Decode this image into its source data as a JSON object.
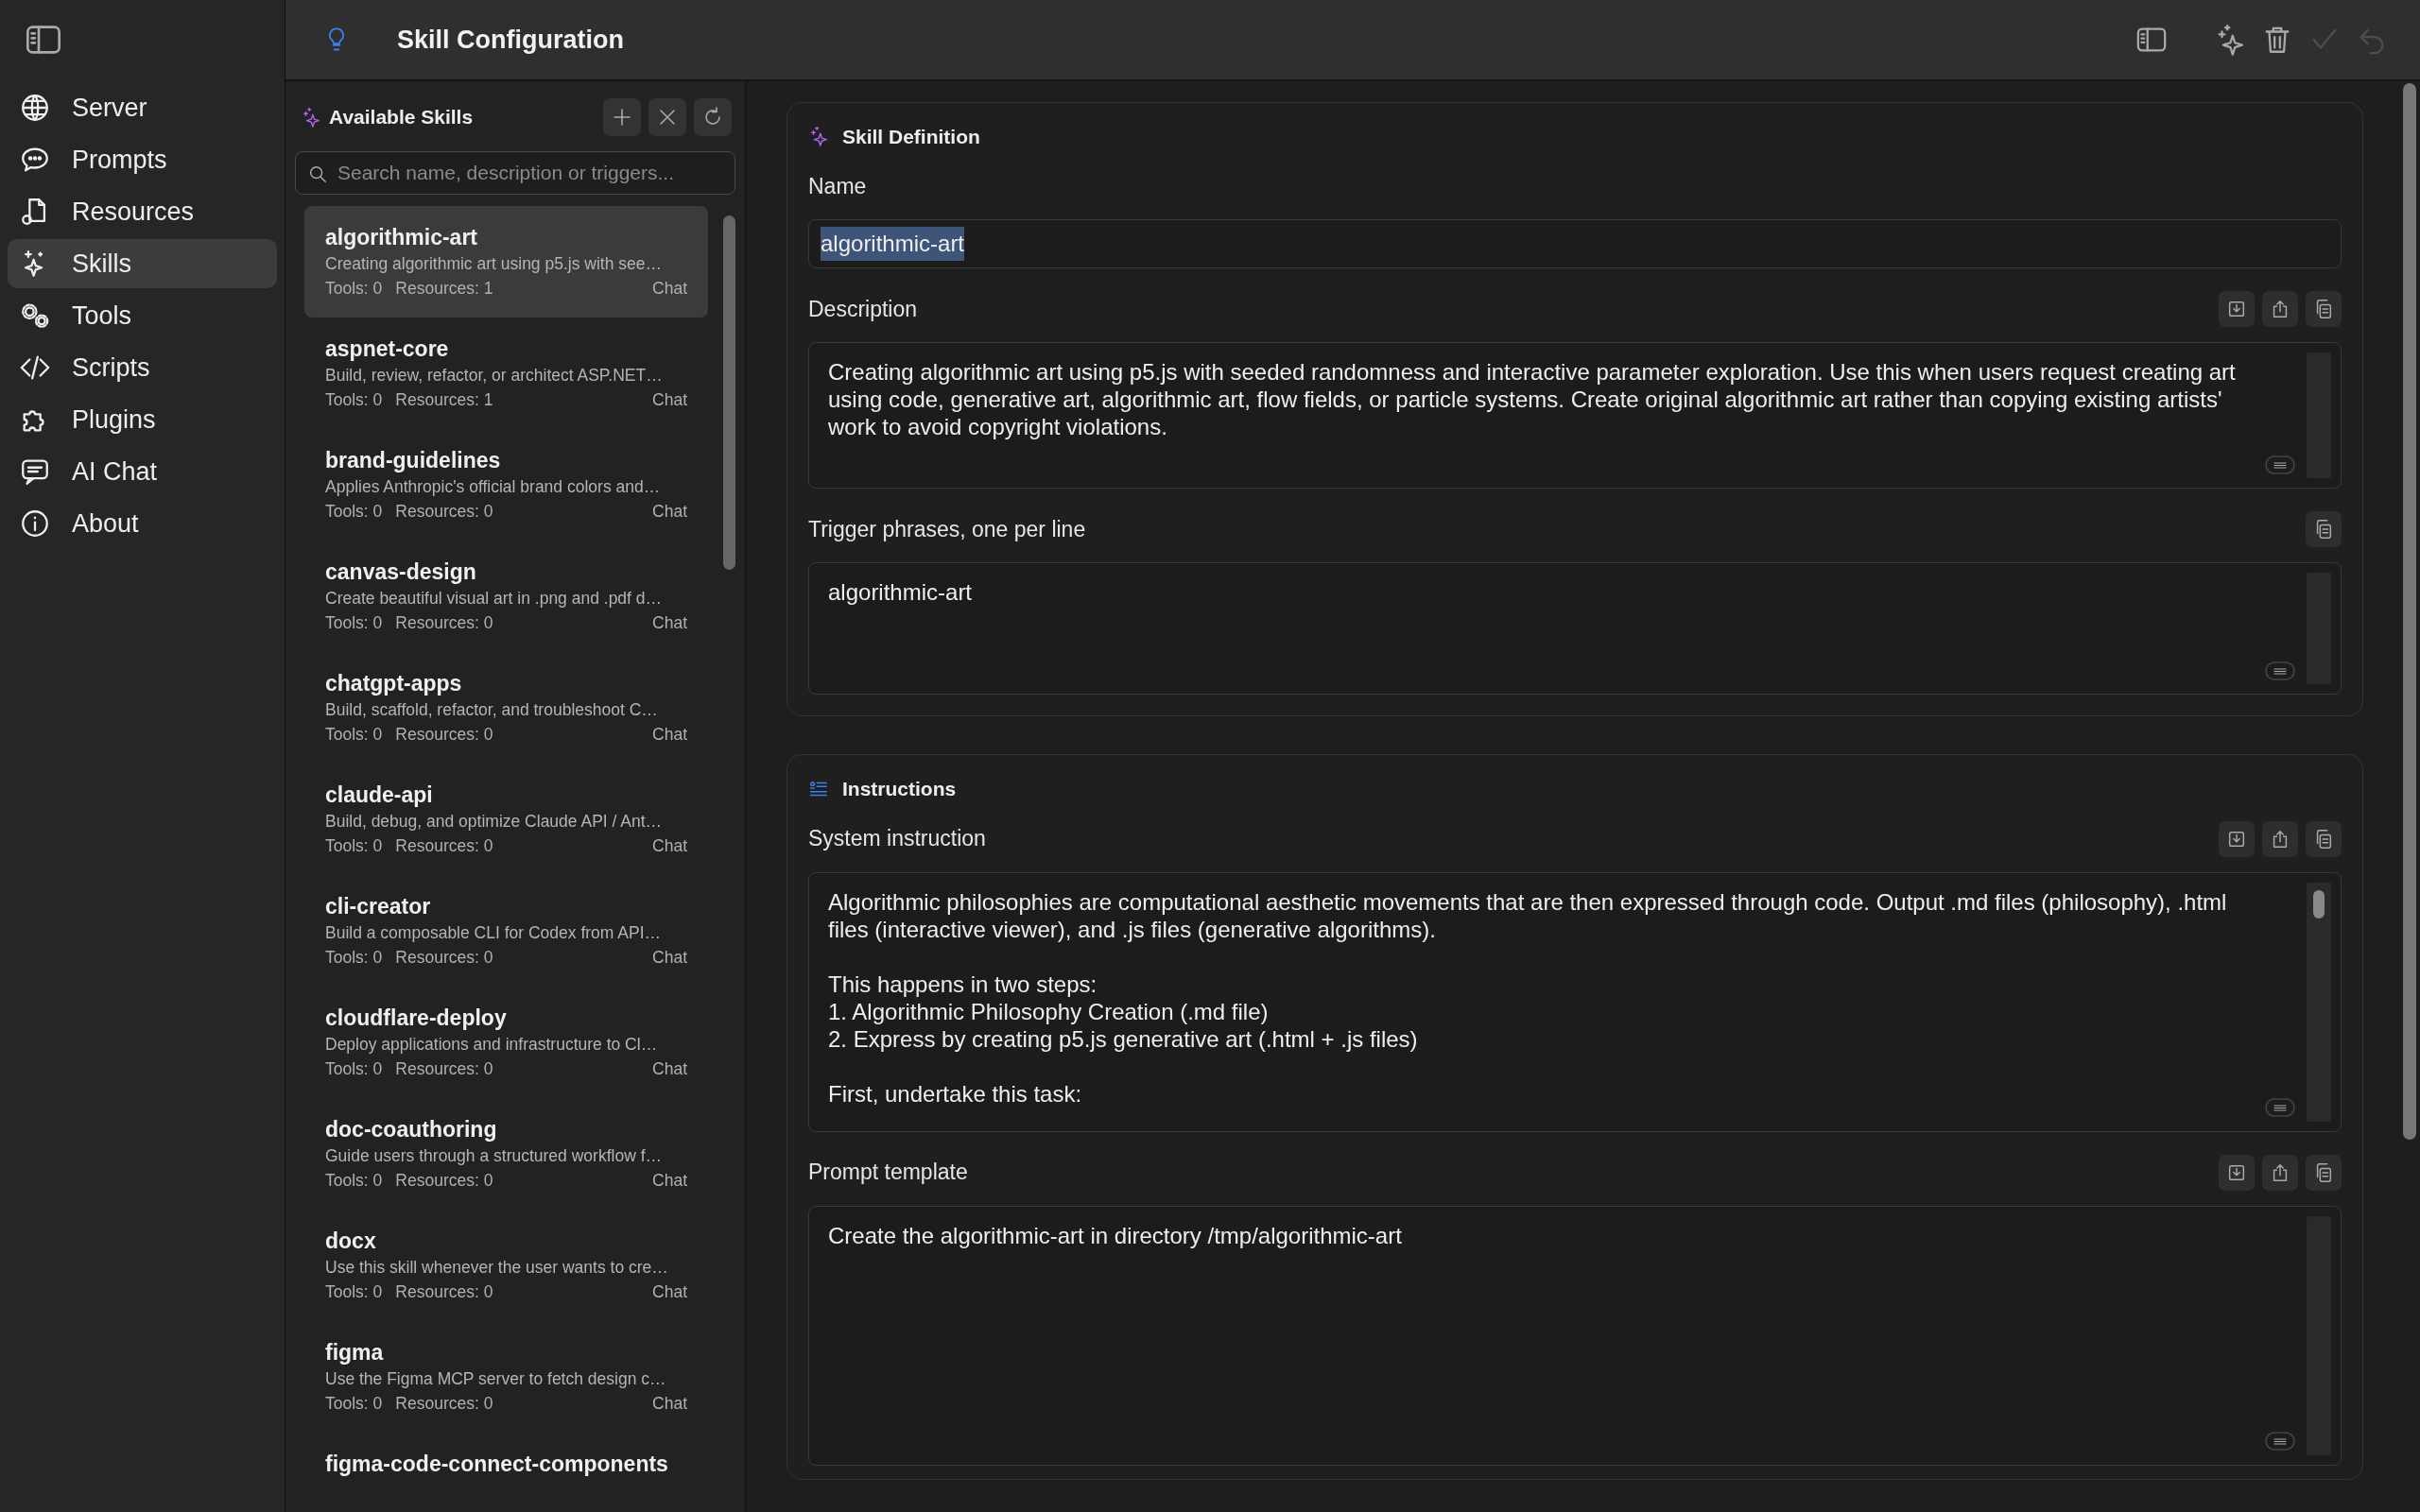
{
  "sidebar": {
    "items": [
      {
        "label": "Server",
        "selected": false
      },
      {
        "label": "Prompts",
        "selected": false
      },
      {
        "label": "Resources",
        "selected": false
      },
      {
        "label": "Skills",
        "selected": true
      },
      {
        "label": "Tools",
        "selected": false
      },
      {
        "label": "Scripts",
        "selected": false
      },
      {
        "label": "Plugins",
        "selected": false
      },
      {
        "label": "AI Chat",
        "selected": false
      },
      {
        "label": "About",
        "selected": false
      }
    ]
  },
  "header": {
    "title": "Skill Configuration",
    "actions": [
      {
        "kind": "panel",
        "disabled": false
      },
      {
        "kind": "sparkle",
        "disabled": false
      },
      {
        "kind": "delete",
        "disabled": false
      },
      {
        "kind": "confirm",
        "disabled": true
      },
      {
        "kind": "undo",
        "disabled": true
      }
    ]
  },
  "skills_panel": {
    "title": "Available Skills",
    "buttons": [
      {
        "kind": "add"
      },
      {
        "kind": "clear"
      },
      {
        "kind": "refresh"
      }
    ],
    "search": {
      "placeholder": "Search name, description or triggers..."
    },
    "items": [
      {
        "name": "algorithmic-art",
        "description": "Creating algorithmic art using p5.js with see…",
        "tools": "Tools: 0",
        "resources": "Resources: 1",
        "mode": "Chat",
        "selected": true
      },
      {
        "name": "aspnet-core",
        "description": "Build, review, refactor, or architect ASP.NET…",
        "tools": "Tools: 0",
        "resources": "Resources: 1",
        "mode": "Chat",
        "selected": false
      },
      {
        "name": "brand-guidelines",
        "description": "Applies Anthropic's official brand colors and…",
        "tools": "Tools: 0",
        "resources": "Resources: 0",
        "mode": "Chat",
        "selected": false
      },
      {
        "name": "canvas-design",
        "description": "Create beautiful visual art in .png and .pdf d…",
        "tools": "Tools: 0",
        "resources": "Resources: 0",
        "mode": "Chat",
        "selected": false
      },
      {
        "name": "chatgpt-apps",
        "description": "Build, scaffold, refactor, and troubleshoot C…",
        "tools": "Tools: 0",
        "resources": "Resources: 0",
        "mode": "Chat",
        "selected": false
      },
      {
        "name": "claude-api",
        "description": "Build, debug, and optimize Claude API / Ant…",
        "tools": "Tools: 0",
        "resources": "Resources: 0",
        "mode": "Chat",
        "selected": false
      },
      {
        "name": "cli-creator",
        "description": "Build a composable CLI for Codex from API…",
        "tools": "Tools: 0",
        "resources": "Resources: 0",
        "mode": "Chat",
        "selected": false
      },
      {
        "name": "cloudflare-deploy",
        "description": "Deploy applications and infrastructure to Cl…",
        "tools": "Tools: 0",
        "resources": "Resources: 0",
        "mode": "Chat",
        "selected": false
      },
      {
        "name": "doc-coauthoring",
        "description": "Guide users through a structured workflow f…",
        "tools": "Tools: 0",
        "resources": "Resources: 0",
        "mode": "Chat",
        "selected": false
      },
      {
        "name": "docx",
        "description": "Use this skill whenever the user wants to cre…",
        "tools": "Tools: 0",
        "resources": "Resources: 0",
        "mode": "Chat",
        "selected": false
      },
      {
        "name": "figma",
        "description": "Use the Figma MCP server to fetch design c…",
        "tools": "Tools: 0",
        "resources": "Resources: 0",
        "mode": "Chat",
        "selected": false
      },
      {
        "name": "figma-code-connect-components",
        "selected": false
      }
    ]
  },
  "sections": [
    {
      "kind": "definition",
      "title": "Skill Definition",
      "fields": [
        {
          "kind": "line",
          "label": "Name",
          "value": "algorithmic-art",
          "text_selected": true
        },
        {
          "kind": "area",
          "label": "Description",
          "value": "Creating algorithmic art using p5.js with seeded randomness and interactive parameter exploration. Use this when users request creating art using code, generative art, algorithmic art, flow fields, or particle systems. Create original algorithmic art rather than copying existing artists' work to avoid copyright violations.",
          "actions": [
            {
              "kind": "import"
            },
            {
              "kind": "export"
            },
            {
              "kind": "copy"
            }
          ]
        },
        {
          "kind": "area",
          "label": "Trigger phrases, one per line",
          "value": "algorithmic-art",
          "actions": [
            {
              "kind": "copy"
            }
          ]
        }
      ]
    },
    {
      "kind": "instructions",
      "title": "Instructions",
      "fields": [
        {
          "kind": "area",
          "label": "System instruction",
          "value": "Algorithmic philosophies are computational aesthetic movements that are then expressed through code. Output .md files (philosophy), .html files (interactive viewer), and .js files (generative algorithms).\n\nThis happens in two steps:\n1. Algorithmic Philosophy Creation (.md file)\n2. Express by creating p5.js generative art (.html + .js files)\n\nFirst, undertake this task:",
          "scrolled": true,
          "actions": [
            {
              "kind": "import"
            },
            {
              "kind": "export"
            },
            {
              "kind": "copy"
            }
          ]
        },
        {
          "kind": "area",
          "label": "Prompt template",
          "value": "Create the algorithmic-art in directory /tmp/algorithmic-art",
          "actions": [
            {
              "kind": "import"
            },
            {
              "kind": "export"
            },
            {
              "kind": "copy"
            }
          ]
        }
      ]
    }
  ]
}
